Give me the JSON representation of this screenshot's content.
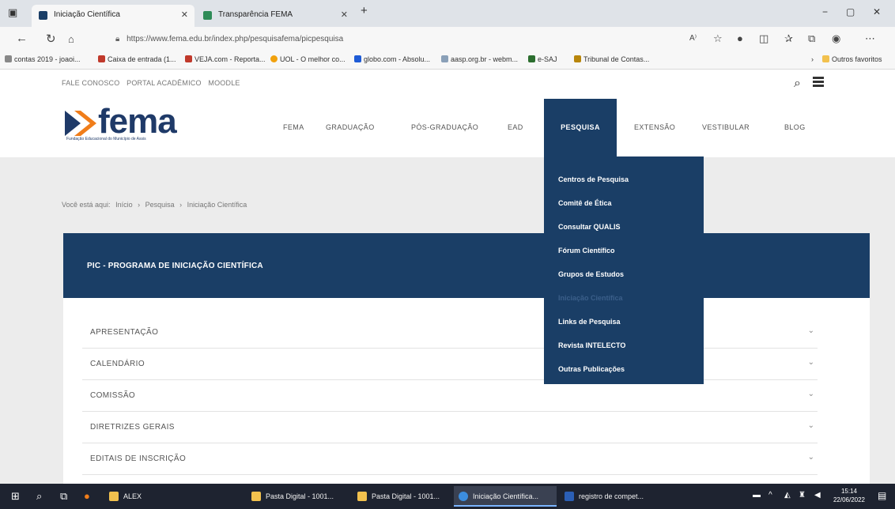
{
  "browser": {
    "tabs": [
      {
        "title": "Iniciação Científica",
        "active": true
      },
      {
        "title": "Transparência FEMA",
        "active": false
      }
    ],
    "new_tab_label": "+",
    "window_controls": {
      "minimize": "−",
      "maximize": "▢",
      "close": "✕"
    },
    "url": "https://www.fema.edu.br/index.php/pesquisafema/picpesquisa",
    "bookmarks": [
      {
        "label": "contas 2019 - joaoi...",
        "color": "#888888"
      },
      {
        "label": "Caixa de entrada (1...",
        "color": "#c0392b"
      },
      {
        "label": "VEJA.com - Reporta...",
        "color": "#c0392b"
      },
      {
        "label": "UOL - O melhor co...",
        "color": "#f1a10d"
      },
      {
        "label": "globo.com - Absolu...",
        "color": "#1e5bd6"
      },
      {
        "label": "aasp.org.br - webm...",
        "color": "#8aa0b8"
      },
      {
        "label": "e-SAJ",
        "color": "#2c6e2f"
      },
      {
        "label": "Tribunal de Contas...",
        "color": "#b8860b"
      }
    ],
    "bookmarks_overflow": "›",
    "other_favorites": "Outros favoritos"
  },
  "site": {
    "toplinks": [
      "FALE CONOSCO",
      "PORTAL ACADÊMICO",
      "MOODLE"
    ],
    "logo": {
      "text": "fema",
      "subtitle": "Fundação Educacional do Município de Assis"
    },
    "menu": [
      "FEMA",
      "GRADUAÇÃO",
      "PÓS-GRADUAÇÃO",
      "EAD",
      "PESQUISA",
      "EXTENSÃO",
      "VESTIBULAR",
      "BLOG"
    ],
    "breadcrumb": [
      "Você está aqui:",
      "Início",
      "›",
      "Pesquisa",
      "›",
      "Iniciação Científica"
    ],
    "banner_title": "PIC - PROGRAMA DE INICIAÇÃO CIENTÍFICA",
    "accordion": [
      "APRESENTAÇÃO",
      "CALENDÁRIO",
      "COMISSÃO",
      "DIRETRIZES GERAIS",
      "EDITAIS DE INSCRIÇÃO"
    ],
    "dropdown": [
      "Centros de Pesquisa",
      "Comitê de Ética",
      "Consultar QUALIS",
      "Fórum Científico",
      "Grupos de Estudos",
      "Iniciação Científica",
      "Links de Pesquisa",
      "Revista INTELECTO",
      "Outras Publicações"
    ],
    "dropdown_current_index": 5,
    "brand_color": "#1a3e66"
  },
  "taskbar": {
    "apps": [
      {
        "label": "ALEX",
        "color": "#f2c14e",
        "active": false
      },
      {
        "label": "Pasta Digital - 1001...",
        "color": "#f2c14e",
        "active": false
      },
      {
        "label": "Pasta Digital - 1001...",
        "color": "#f2c14e",
        "active": false
      },
      {
        "label": "Iniciação Científica...",
        "color": "#3c8dde",
        "active": true
      },
      {
        "label": "registro de compet...",
        "color": "#2b5fb5",
        "active": false
      }
    ],
    "time": "15:14",
    "date": "22/06/2022"
  }
}
